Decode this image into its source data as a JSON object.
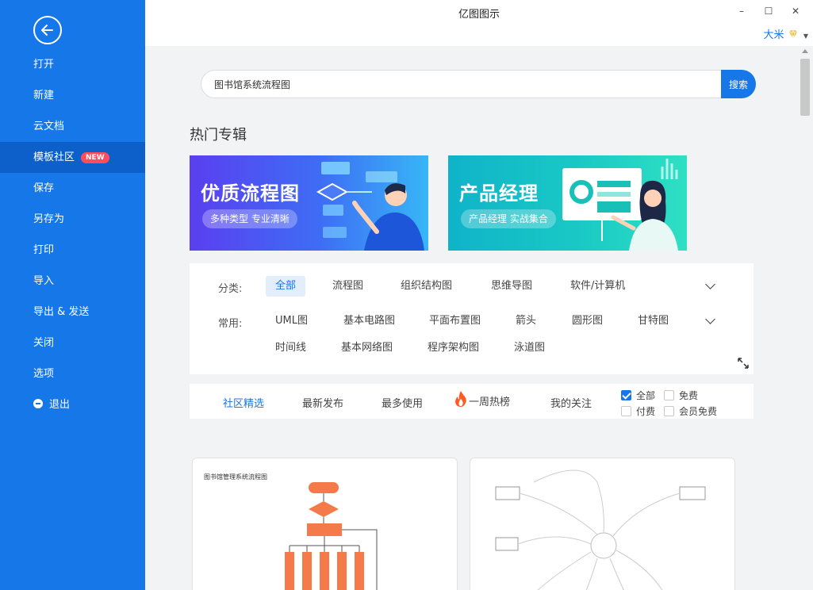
{
  "app": {
    "title": "亿图图示"
  },
  "window": {
    "minimize": "–",
    "maximize": "☐",
    "close": "✕"
  },
  "user": {
    "name": "大米"
  },
  "sidebar": {
    "items": [
      {
        "label": "打开"
      },
      {
        "label": "新建"
      },
      {
        "label": "云文档"
      },
      {
        "label": "模板社区",
        "badge": "NEW",
        "active": true
      },
      {
        "label": "保存"
      },
      {
        "label": "另存为"
      },
      {
        "label": "打印"
      },
      {
        "label": "导入"
      },
      {
        "label": "导出 & 发送"
      },
      {
        "label": "关闭"
      },
      {
        "label": "选项"
      },
      {
        "label": "退出"
      }
    ]
  },
  "search": {
    "value": "图书馆系统流程图",
    "button_label": "搜索"
  },
  "featured": {
    "title": "热门专辑",
    "banners": [
      {
        "title": "优质流程图",
        "subtitle": "多种类型 专业清晰"
      },
      {
        "title": "产品经理",
        "subtitle": "产品经理 实战集合"
      }
    ]
  },
  "filters": {
    "category_label": "分类:",
    "categories": [
      "全部",
      "流程图",
      "组织结构图",
      "思维导图",
      "软件/计算机"
    ],
    "common_label": "常用:",
    "common_row1": [
      "UML图",
      "基本电路图",
      "平面布置图",
      "箭头",
      "圆形图",
      "甘特图"
    ],
    "common_row2": [
      "时间线",
      "基本网络图",
      "程序架构图",
      "泳道图"
    ]
  },
  "tabs": {
    "items": [
      "社区精选",
      "最新发布",
      "最多使用",
      "一周热榜",
      "我的关注"
    ],
    "checkboxes": [
      {
        "label": "全部",
        "checked": true
      },
      {
        "label": "免费",
        "checked": false
      },
      {
        "label": "付费",
        "checked": false
      },
      {
        "label": "会员免费",
        "checked": false
      }
    ]
  },
  "cards": [
    {
      "title": "图书馆管理系统流程图"
    },
    {
      "title": ""
    }
  ],
  "colors": {
    "primary": "#1677e8",
    "sidebar_active": "#0d5fc9",
    "badge": "#ff4d5e",
    "flow_orange": "#f47a4a"
  }
}
